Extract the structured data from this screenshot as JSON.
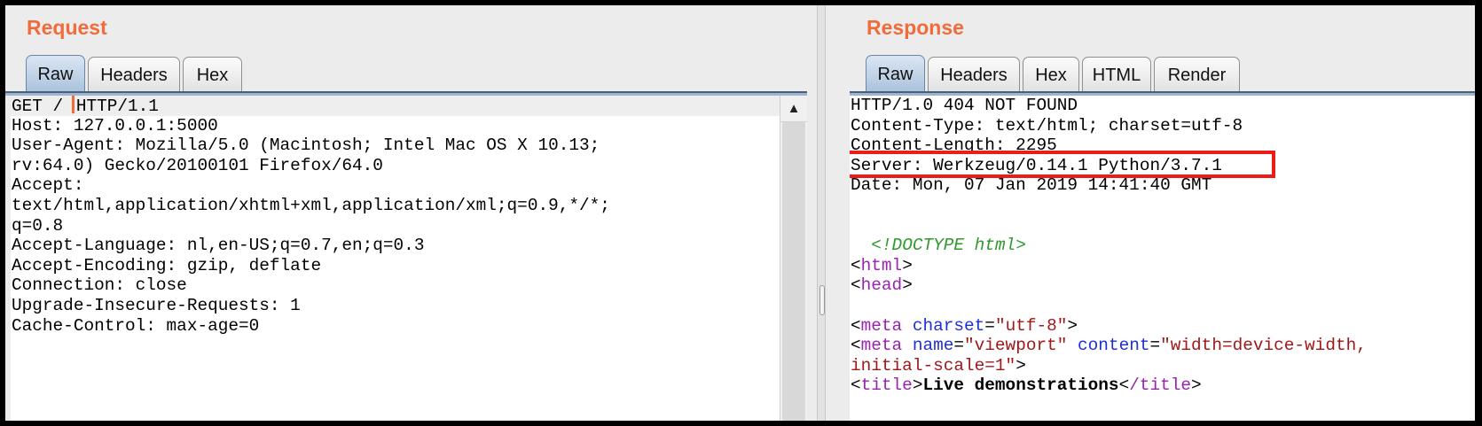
{
  "request": {
    "title": "Request",
    "tabs": [
      "Raw",
      "Headers",
      "Hex"
    ],
    "active_tab": "Raw",
    "first_line_before_caret": "GET /",
    "first_line_after_caret": "HTTP/1.1",
    "lines": [
      "Host: 127.0.0.1:5000",
      "User-Agent: Mozilla/5.0 (Macintosh; Intel Mac OS X 10.13;",
      "rv:64.0) Gecko/20100101 Firefox/64.0",
      "Accept:",
      "text/html,application/xhtml+xml,application/xml;q=0.9,*/*;",
      "q=0.8",
      "Accept-Language: nl,en-US;q=0.7,en;q=0.3",
      "Accept-Encoding: gzip, deflate",
      "Connection: close",
      "Upgrade-Insecure-Requests: 1",
      "Cache-Control: max-age=0"
    ]
  },
  "response": {
    "title": "Response",
    "tabs": [
      "Raw",
      "Headers",
      "Hex",
      "HTML",
      "Render"
    ],
    "active_tab": "Raw",
    "status_line": "HTTP/1.0 404 NOT FOUND",
    "content_type": "Content-Type: text/html; charset=utf-8",
    "content_length": "Content-Length: 2295",
    "server": "Server: Werkzeug/0.14.1 Python/3.7.1",
    "date": "Date: Mon, 07 Jan 2019 14:41:40 GMT",
    "doctype": "<!DOCTYPE html>",
    "html_open": "html",
    "head_open": "head",
    "meta1": {
      "tag": "meta",
      "attr": "charset",
      "value": "\"utf-8\""
    },
    "meta2": {
      "tag": "meta",
      "attr1": "name",
      "value1": "\"viewport\"",
      "attr2": "content",
      "value2": "\"width=device-width,",
      "value2_cont": "initial-scale=1\""
    },
    "title_tag": {
      "tag": "title",
      "text": "Live demonstrations",
      "close_tag": "/title"
    }
  },
  "colors": {
    "pane_title": "#f26b3a",
    "highlight_box": "#ee1c17",
    "active_tab": "#a9c1dc",
    "doctype": "#2e9a2e",
    "tag": "#9b22b0",
    "attribute": "#1f2fd6",
    "attribute_value": "#a01818"
  },
  "icons": {
    "scroll_up": "▲"
  }
}
